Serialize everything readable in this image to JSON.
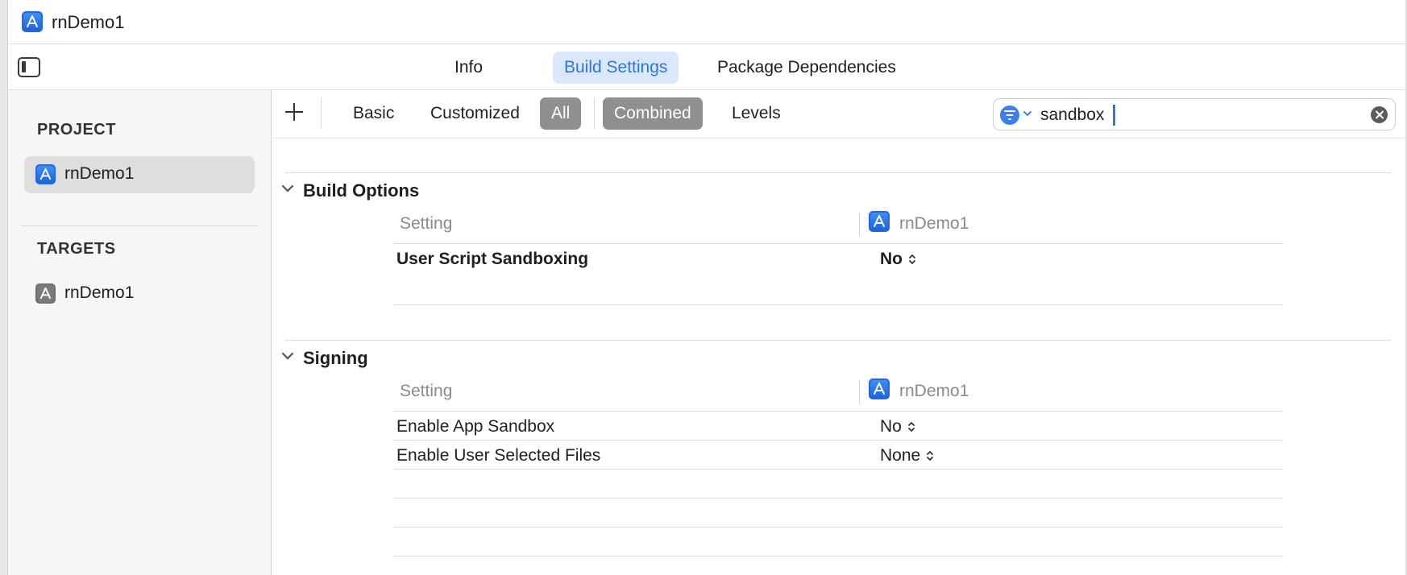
{
  "window": {
    "title": "rnDemo1"
  },
  "tabs": [
    {
      "label": "Info",
      "active": false
    },
    {
      "label": "Build Settings",
      "active": true
    },
    {
      "label": "Package Dependencies",
      "active": false
    }
  ],
  "sidebar": {
    "project_header": "PROJECT",
    "project_items": [
      {
        "label": "rnDemo1",
        "selected": true
      }
    ],
    "targets_header": "TARGETS",
    "target_items": [
      {
        "label": "rnDemo1",
        "selected": false
      }
    ]
  },
  "filterbar": {
    "segments_primary": [
      "Basic",
      "Customized",
      "All"
    ],
    "segments_secondary": [
      "Combined",
      "Levels"
    ],
    "active_primary": "All",
    "active_secondary": "Combined",
    "search": {
      "value": "sandbox"
    }
  },
  "groups": [
    {
      "title": "Build Options",
      "column_setting": "Setting",
      "column_target": "rnDemo1",
      "rows": [
        {
          "name": "User Script Sandboxing",
          "value": "No",
          "bold": true
        }
      ]
    },
    {
      "title": "Signing",
      "column_setting": "Setting",
      "column_target": "rnDemo1",
      "rows": [
        {
          "name": "Enable App Sandbox",
          "value": "No",
          "bold": false
        },
        {
          "name": "Enable User Selected Files",
          "value": "None",
          "bold": false
        }
      ]
    }
  ],
  "colors": {
    "accent": "#2f75e0",
    "selected_tab_bg": "#dbe8fb",
    "segment_on_bg": "#8f8f8f"
  },
  "icons": {
    "app": "xcode-app-icon",
    "sidebar_toggle": "sidebar-toggle-icon",
    "add": "plus-icon",
    "filter": "filter-icon",
    "clear": "clear-search-icon",
    "disclosure": "chevron-down-icon",
    "stepper": "up-down-chevron-icon"
  }
}
